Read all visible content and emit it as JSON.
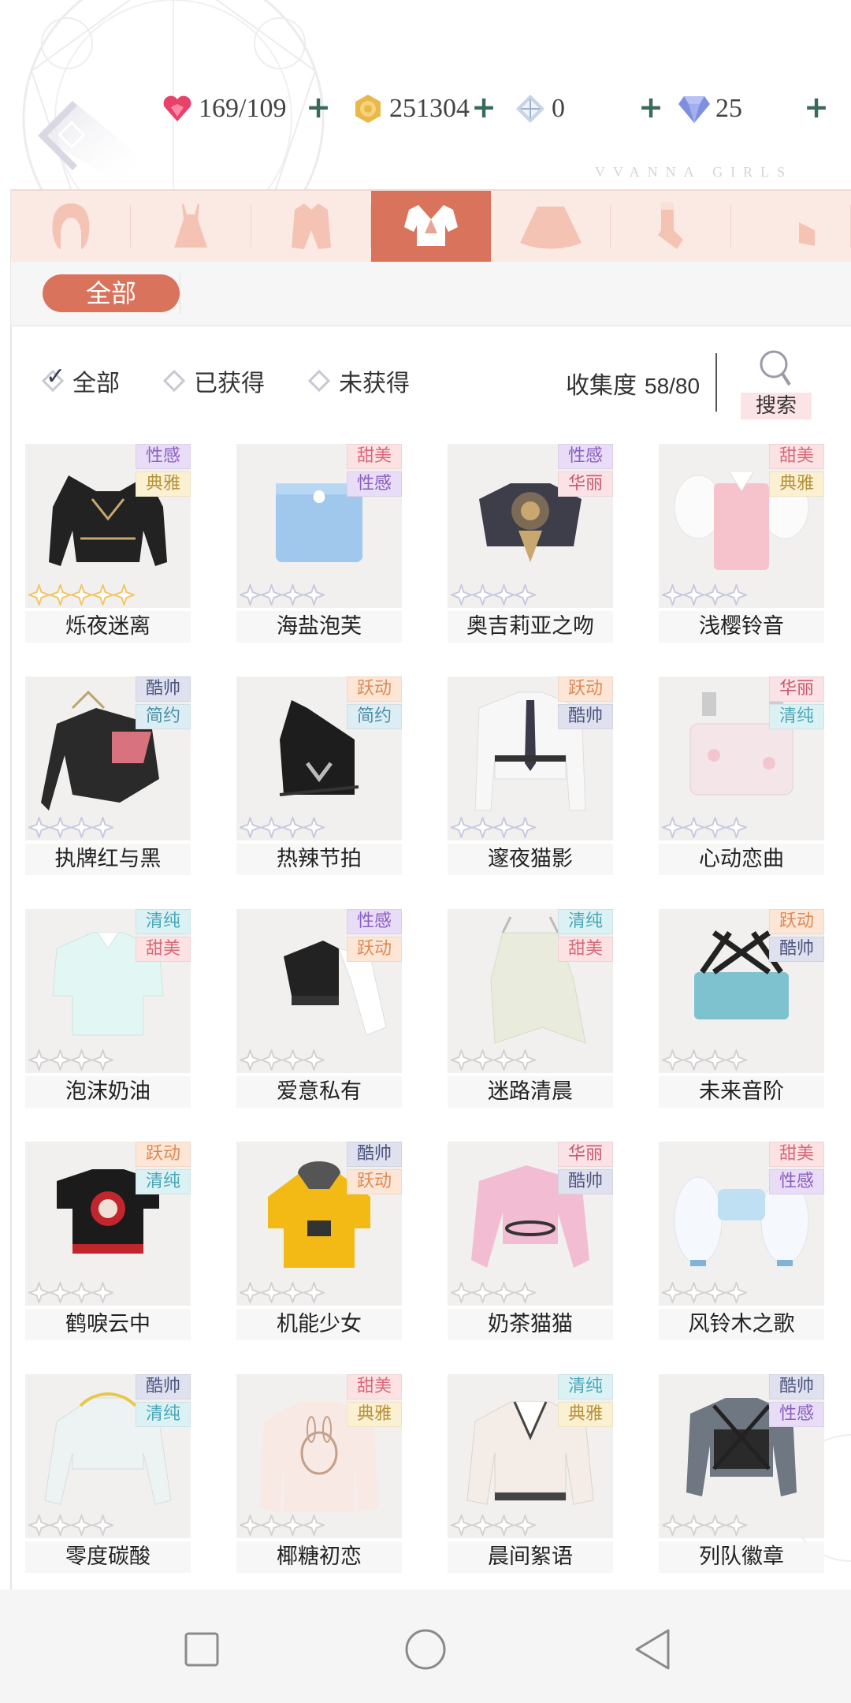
{
  "header": {
    "brand": "VVANNA GIRLS",
    "currencies": [
      {
        "icon": "heart-gem-icon",
        "value": "169/109"
      },
      {
        "icon": "gold-coin-icon",
        "value": "251304"
      },
      {
        "icon": "crystal-ticket-icon",
        "value": "0"
      },
      {
        "icon": "diamond-icon",
        "value": "25"
      }
    ],
    "plus_label": "+"
  },
  "category_tabs": [
    {
      "icon": "hair-icon",
      "active": false
    },
    {
      "icon": "dress-icon",
      "active": false
    },
    {
      "icon": "coat-icon",
      "active": false
    },
    {
      "icon": "top-icon",
      "active": true
    },
    {
      "icon": "skirt-icon",
      "active": false
    },
    {
      "icon": "socks-icon",
      "active": false
    },
    {
      "icon": "shoes-icon",
      "active": false
    }
  ],
  "sub_filter": {
    "selected": "全部"
  },
  "filters": [
    {
      "label": "全部",
      "checked": true
    },
    {
      "label": "已获得",
      "checked": false
    },
    {
      "label": "未获得",
      "checked": false
    }
  ],
  "collection": {
    "label": "收集度",
    "value": "58/80"
  },
  "search": {
    "label": "搜索"
  },
  "tag_colors": {
    "性感": {
      "bg": "#e9dcf6",
      "fg": "#8a5fc0"
    },
    "典雅": {
      "bg": "#fbf1d2",
      "fg": "#b8923c"
    },
    "甜美": {
      "bg": "#fde2e4",
      "fg": "#d66a78"
    },
    "华丽": {
      "bg": "#fbe2e6",
      "fg": "#c45a6c"
    },
    "酷帅": {
      "bg": "#dfe1ee",
      "fg": "#4e5680"
    },
    "简约": {
      "bg": "#dcedf3",
      "fg": "#4b8fa6"
    },
    "跃动": {
      "bg": "#fde6d6",
      "fg": "#dd8a55"
    },
    "清纯": {
      "bg": "#dbf1f4",
      "fg": "#4aa8b8"
    }
  },
  "items": [
    {
      "name": "烁夜迷离",
      "tags": [
        "性感",
        "典雅"
      ],
      "stars": 5,
      "star_color": "#f3c567",
      "garment": "black-lace-top"
    },
    {
      "name": "海盐泡芙",
      "tags": [
        "甜美",
        "性感"
      ],
      "stars": 4,
      "star_color": "#c9c9e0",
      "garment": "blue-tube-top"
    },
    {
      "name": "奥吉莉亚之吻",
      "tags": [
        "性感",
        "华丽"
      ],
      "stars": 4,
      "star_color": "#c9c9e0",
      "garment": "ornate-dark-top"
    },
    {
      "name": "浅樱铃音",
      "tags": [
        "甜美",
        "典雅"
      ],
      "stars": 4,
      "star_color": "#c9c9e0",
      "garment": "pink-vest-top"
    },
    {
      "name": "执牌红与黑",
      "tags": [
        "酷帅",
        "简约"
      ],
      "stars": 4,
      "star_color": "#c9c9e0",
      "garment": "black-red-top"
    },
    {
      "name": "热辣节拍",
      "tags": [
        "跃动",
        "简约"
      ],
      "stars": 4,
      "star_color": "#c9c9e0",
      "garment": "black-one-shoulder"
    },
    {
      "name": "邃夜猫影",
      "tags": [
        "跃动",
        "酷帅"
      ],
      "stars": 4,
      "star_color": "#c9c9e0",
      "garment": "white-shirt-tie"
    },
    {
      "name": "心动恋曲",
      "tags": [
        "华丽",
        "清纯"
      ],
      "stars": 4,
      "star_color": "#c9c9e0",
      "garment": "lace-corset"
    },
    {
      "name": "泡沫奶油",
      "tags": [
        "清纯",
        "甜美"
      ],
      "stars": 4,
      "star_color": "#d2d2d2",
      "garment": "mint-blouse"
    },
    {
      "name": "爱意私有",
      "tags": [
        "性感",
        "跃动"
      ],
      "stars": 4,
      "star_color": "#d2d2d2",
      "garment": "black-white-sleeve"
    },
    {
      "name": "迷路清晨",
      "tags": [
        "清纯",
        "甜美"
      ],
      "stars": 4,
      "star_color": "#d2d2d2",
      "garment": "cream-lace-top"
    },
    {
      "name": "未来音阶",
      "tags": [
        "跃动",
        "酷帅"
      ],
      "stars": 4,
      "star_color": "#d2d2d2",
      "garment": "blue-sport-bra"
    },
    {
      "name": "鹤唳云中",
      "tags": [
        "跃动",
        "清纯"
      ],
      "stars": 4,
      "star_color": "#d2d2d2",
      "garment": "black-red-tee"
    },
    {
      "name": "机能少女",
      "tags": [
        "酷帅",
        "跃动"
      ],
      "stars": 4,
      "star_color": "#d2d2d2",
      "garment": "yellow-hoodie"
    },
    {
      "name": "奶茶猫猫",
      "tags": [
        "华丽",
        "酷帅"
      ],
      "stars": 4,
      "star_color": "#d2d2d2",
      "garment": "pink-satin-top"
    },
    {
      "name": "风铃木之歌",
      "tags": [
        "甜美",
        "性感"
      ],
      "stars": 4,
      "star_color": "#d2d2d2",
      "garment": "white-puff-sleeve"
    },
    {
      "name": "零度碳酸",
      "tags": [
        "酷帅",
        "清纯"
      ],
      "stars": 4,
      "star_color": "#d2d2d2",
      "garment": "white-crop-jacket"
    },
    {
      "name": "椰糖初恋",
      "tags": [
        "甜美",
        "典雅"
      ],
      "stars": 4,
      "star_color": "#d2d2d2",
      "garment": "bunny-sweater"
    },
    {
      "name": "晨间絮语",
      "tags": [
        "清纯",
        "典雅"
      ],
      "stars": 4,
      "star_color": "#d2d2d2",
      "garment": "cream-vneck-sweater"
    },
    {
      "name": "列队徽章",
      "tags": [
        "酷帅",
        "性感"
      ],
      "stars": 4,
      "star_color": "#d2d2d2",
      "garment": "grey-harness-top"
    }
  ],
  "nav": [
    {
      "icon": "recent-apps-icon"
    },
    {
      "icon": "home-icon"
    },
    {
      "icon": "back-icon"
    }
  ]
}
